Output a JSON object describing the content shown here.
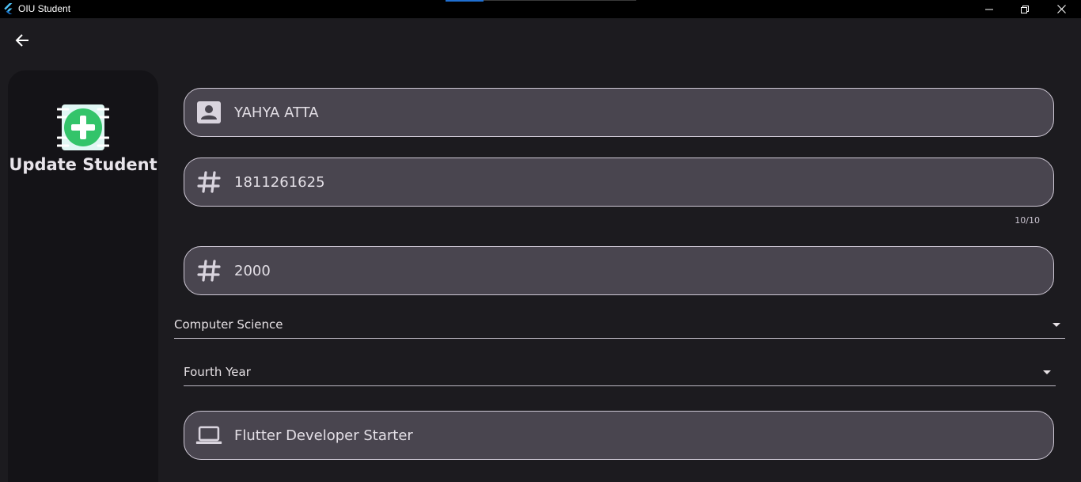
{
  "window": {
    "title": "OIU Student"
  },
  "sidebar": {
    "title": "Update Student",
    "icon": "add-student-icon"
  },
  "form": {
    "name": {
      "value": "YAHYA ATTA",
      "icon": "person-card-icon"
    },
    "student_id": {
      "value": "1811261625",
      "icon": "hash-icon",
      "counter": "10/10"
    },
    "year_of_entry": {
      "value": "2000",
      "icon": "hash-icon"
    },
    "department": {
      "value": "Computer Science"
    },
    "level": {
      "value": "Fourth Year"
    },
    "job": {
      "value": "Flutter Developer Starter",
      "icon": "laptop-icon"
    }
  },
  "colors": {
    "background": "#1c1b1f",
    "field": "#49454f",
    "accent": "#3ccf6e"
  }
}
